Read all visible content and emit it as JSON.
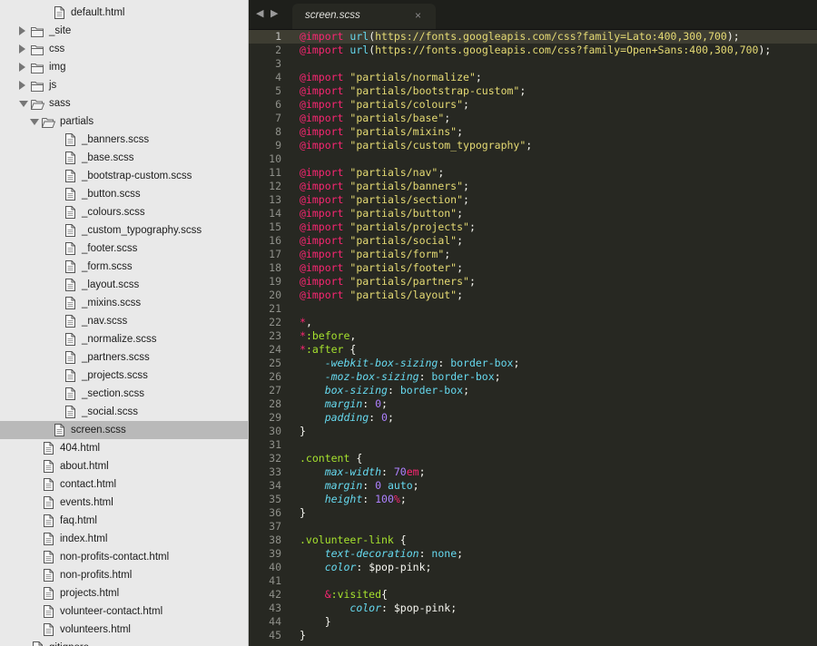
{
  "sidebar": {
    "rows": [
      {
        "type": "file",
        "label": "default.html",
        "depth": 3,
        "selected": false
      },
      {
        "type": "folder",
        "label": "_site",
        "depth": 1,
        "expanded": false
      },
      {
        "type": "folder",
        "label": "css",
        "depth": 1,
        "expanded": false
      },
      {
        "type": "folder",
        "label": "img",
        "depth": 1,
        "expanded": false
      },
      {
        "type": "folder",
        "label": "js",
        "depth": 1,
        "expanded": false
      },
      {
        "type": "folder",
        "label": "sass",
        "depth": 1,
        "expanded": true
      },
      {
        "type": "folder",
        "label": "partials",
        "depth": 2,
        "expanded": true
      },
      {
        "type": "file",
        "label": "_banners.scss",
        "depth": 4
      },
      {
        "type": "file",
        "label": "_base.scss",
        "depth": 4
      },
      {
        "type": "file",
        "label": "_bootstrap-custom.scss",
        "depth": 4
      },
      {
        "type": "file",
        "label": "_button.scss",
        "depth": 4
      },
      {
        "type": "file",
        "label": "_colours.scss",
        "depth": 4
      },
      {
        "type": "file",
        "label": "_custom_typography.scss",
        "depth": 4
      },
      {
        "type": "file",
        "label": "_footer.scss",
        "depth": 4
      },
      {
        "type": "file",
        "label": "_form.scss",
        "depth": 4
      },
      {
        "type": "file",
        "label": "_layout.scss",
        "depth": 4
      },
      {
        "type": "file",
        "label": "_mixins.scss",
        "depth": 4
      },
      {
        "type": "file",
        "label": "_nav.scss",
        "depth": 4
      },
      {
        "type": "file",
        "label": "_normalize.scss",
        "depth": 4
      },
      {
        "type": "file",
        "label": "_partners.scss",
        "depth": 4
      },
      {
        "type": "file",
        "label": "_projects.scss",
        "depth": 4
      },
      {
        "type": "file",
        "label": "_section.scss",
        "depth": 4
      },
      {
        "type": "file",
        "label": "_social.scss",
        "depth": 4
      },
      {
        "type": "file",
        "label": "screen.scss",
        "depth": 3,
        "selected": true
      },
      {
        "type": "file",
        "label": "404.html",
        "depth": 2
      },
      {
        "type": "file",
        "label": "about.html",
        "depth": 2
      },
      {
        "type": "file",
        "label": "contact.html",
        "depth": 2
      },
      {
        "type": "file",
        "label": "events.html",
        "depth": 2
      },
      {
        "type": "file",
        "label": "faq.html",
        "depth": 2
      },
      {
        "type": "file",
        "label": "index.html",
        "depth": 2
      },
      {
        "type": "file",
        "label": "non-profits-contact.html",
        "depth": 2
      },
      {
        "type": "file",
        "label": "non-profits.html",
        "depth": 2
      },
      {
        "type": "file",
        "label": "projects.html",
        "depth": 2
      },
      {
        "type": "file",
        "label": "volunteer-contact.html",
        "depth": 2
      },
      {
        "type": "file",
        "label": "volunteers.html",
        "depth": 2
      },
      {
        "type": "file",
        "label": "gitignore",
        "depth": 1
      }
    ]
  },
  "tabbar": {
    "back_glyph": "◀",
    "forward_glyph": "▶",
    "tab_label": "screen.scss",
    "close_glyph": "×"
  },
  "editor": {
    "current_line": 1,
    "lines": [
      [
        [
          "@import",
          "atrule"
        ],
        [
          " ",
          "plain"
        ],
        [
          "url",
          "func"
        ],
        [
          "(",
          "plain"
        ],
        [
          "https://fonts.googleapis.com/css?family=Lato:400,300,700",
          "url"
        ],
        [
          ");",
          "plain"
        ]
      ],
      [
        [
          "@import",
          "atrule"
        ],
        [
          " ",
          "plain"
        ],
        [
          "url",
          "func"
        ],
        [
          "(",
          "plain"
        ],
        [
          "https://fonts.googleapis.com/css?family=Open+Sans:400,300,700",
          "url"
        ],
        [
          ");",
          "plain"
        ]
      ],
      [],
      [
        [
          "@import",
          "atrule"
        ],
        [
          " ",
          "plain"
        ],
        [
          "\"partials/normalize\"",
          "string"
        ],
        [
          ";",
          "plain"
        ]
      ],
      [
        [
          "@import",
          "atrule"
        ],
        [
          " ",
          "plain"
        ],
        [
          "\"partials/bootstrap-custom\"",
          "string"
        ],
        [
          ";",
          "plain"
        ]
      ],
      [
        [
          "@import",
          "atrule"
        ],
        [
          " ",
          "plain"
        ],
        [
          "\"partials/colours\"",
          "string"
        ],
        [
          ";",
          "plain"
        ]
      ],
      [
        [
          "@import",
          "atrule"
        ],
        [
          " ",
          "plain"
        ],
        [
          "\"partials/base\"",
          "string"
        ],
        [
          ";",
          "plain"
        ]
      ],
      [
        [
          "@import",
          "atrule"
        ],
        [
          " ",
          "plain"
        ],
        [
          "\"partials/mixins\"",
          "string"
        ],
        [
          ";",
          "plain"
        ]
      ],
      [
        [
          "@import",
          "atrule"
        ],
        [
          " ",
          "plain"
        ],
        [
          "\"partials/custom_typography\"",
          "string"
        ],
        [
          ";",
          "plain"
        ]
      ],
      [],
      [
        [
          "@import",
          "atrule"
        ],
        [
          " ",
          "plain"
        ],
        [
          "\"partials/nav\"",
          "string"
        ],
        [
          ";",
          "plain"
        ]
      ],
      [
        [
          "@import",
          "atrule"
        ],
        [
          " ",
          "plain"
        ],
        [
          "\"partials/banners\"",
          "string"
        ],
        [
          ";",
          "plain"
        ]
      ],
      [
        [
          "@import",
          "atrule"
        ],
        [
          " ",
          "plain"
        ],
        [
          "\"partials/section\"",
          "string"
        ],
        [
          ";",
          "plain"
        ]
      ],
      [
        [
          "@import",
          "atrule"
        ],
        [
          " ",
          "plain"
        ],
        [
          "\"partials/button\"",
          "string"
        ],
        [
          ";",
          "plain"
        ]
      ],
      [
        [
          "@import",
          "atrule"
        ],
        [
          " ",
          "plain"
        ],
        [
          "\"partials/projects\"",
          "string"
        ],
        [
          ";",
          "plain"
        ]
      ],
      [
        [
          "@import",
          "atrule"
        ],
        [
          " ",
          "plain"
        ],
        [
          "\"partials/social\"",
          "string"
        ],
        [
          ";",
          "plain"
        ]
      ],
      [
        [
          "@import",
          "atrule"
        ],
        [
          " ",
          "plain"
        ],
        [
          "\"partials/form\"",
          "string"
        ],
        [
          ";",
          "plain"
        ]
      ],
      [
        [
          "@import",
          "atrule"
        ],
        [
          " ",
          "plain"
        ],
        [
          "\"partials/footer\"",
          "string"
        ],
        [
          ";",
          "plain"
        ]
      ],
      [
        [
          "@import",
          "atrule"
        ],
        [
          " ",
          "plain"
        ],
        [
          "\"partials/partners\"",
          "string"
        ],
        [
          ";",
          "plain"
        ]
      ],
      [
        [
          "@import",
          "atrule"
        ],
        [
          " ",
          "plain"
        ],
        [
          "\"partials/layout\"",
          "string"
        ],
        [
          ";",
          "plain"
        ]
      ],
      [],
      [
        [
          "*",
          "star"
        ],
        [
          ",",
          "plain"
        ]
      ],
      [
        [
          "*",
          "star"
        ],
        [
          ":before",
          "selector"
        ],
        [
          ",",
          "plain"
        ]
      ],
      [
        [
          "*",
          "star"
        ],
        [
          ":after",
          "selector"
        ],
        [
          " {",
          "plain"
        ]
      ],
      [
        [
          "    ",
          "plain"
        ],
        [
          "-webkit-box-sizing",
          "prop"
        ],
        [
          ": ",
          "plain"
        ],
        [
          "border-box",
          "value"
        ],
        [
          ";",
          "plain"
        ]
      ],
      [
        [
          "    ",
          "plain"
        ],
        [
          "-moz-box-sizing",
          "prop"
        ],
        [
          ": ",
          "plain"
        ],
        [
          "border-box",
          "value"
        ],
        [
          ";",
          "plain"
        ]
      ],
      [
        [
          "    ",
          "plain"
        ],
        [
          "box-sizing",
          "prop"
        ],
        [
          ": ",
          "plain"
        ],
        [
          "border-box",
          "value"
        ],
        [
          ";",
          "plain"
        ]
      ],
      [
        [
          "    ",
          "plain"
        ],
        [
          "margin",
          "prop"
        ],
        [
          ": ",
          "plain"
        ],
        [
          "0",
          "number"
        ],
        [
          ";",
          "plain"
        ]
      ],
      [
        [
          "    ",
          "plain"
        ],
        [
          "padding",
          "prop"
        ],
        [
          ": ",
          "plain"
        ],
        [
          "0",
          "number"
        ],
        [
          ";",
          "plain"
        ]
      ],
      [
        [
          "}",
          "plain"
        ]
      ],
      [],
      [
        [
          ".content",
          "selector"
        ],
        [
          " {",
          "plain"
        ]
      ],
      [
        [
          "    ",
          "plain"
        ],
        [
          "max-width",
          "prop"
        ],
        [
          ": ",
          "plain"
        ],
        [
          "70",
          "number"
        ],
        [
          "em",
          "unit"
        ],
        [
          ";",
          "plain"
        ]
      ],
      [
        [
          "    ",
          "plain"
        ],
        [
          "margin",
          "prop"
        ],
        [
          ": ",
          "plain"
        ],
        [
          "0",
          "number"
        ],
        [
          " auto",
          "value"
        ],
        [
          ";",
          "plain"
        ]
      ],
      [
        [
          "    ",
          "plain"
        ],
        [
          "height",
          "prop"
        ],
        [
          ": ",
          "plain"
        ],
        [
          "100",
          "number"
        ],
        [
          "%",
          "unit"
        ],
        [
          ";",
          "plain"
        ]
      ],
      [
        [
          "}",
          "plain"
        ]
      ],
      [],
      [
        [
          ".volunteer-link",
          "selector"
        ],
        [
          " {",
          "plain"
        ]
      ],
      [
        [
          "    ",
          "plain"
        ],
        [
          "text-decoration",
          "prop"
        ],
        [
          ": ",
          "plain"
        ],
        [
          "none",
          "value"
        ],
        [
          ";",
          "plain"
        ]
      ],
      [
        [
          "    ",
          "plain"
        ],
        [
          "color",
          "prop"
        ],
        [
          ": ",
          "plain"
        ],
        [
          "$pop-pink",
          "plain"
        ],
        [
          ";",
          "plain"
        ]
      ],
      [],
      [
        [
          "    ",
          "plain"
        ],
        [
          "&",
          "amp"
        ],
        [
          ":visited",
          "selector"
        ],
        [
          "{",
          "plain"
        ]
      ],
      [
        [
          "        ",
          "plain"
        ],
        [
          "color",
          "prop"
        ],
        [
          ": ",
          "plain"
        ],
        [
          "$pop-pink",
          "plain"
        ],
        [
          ";",
          "plain"
        ]
      ],
      [
        [
          "    ",
          "plain"
        ],
        [
          "}",
          "plain"
        ]
      ],
      [
        [
          "}",
          "plain"
        ]
      ]
    ]
  },
  "colors": {
    "editor_bg": "#272822",
    "sidebar_bg": "#e9e9e9",
    "selected_row": "#b9b9b9",
    "atrule": "#f92672",
    "string": "#e6db74",
    "selector": "#a6e22e",
    "property": "#66d9ef",
    "number": "#ae81ff"
  }
}
